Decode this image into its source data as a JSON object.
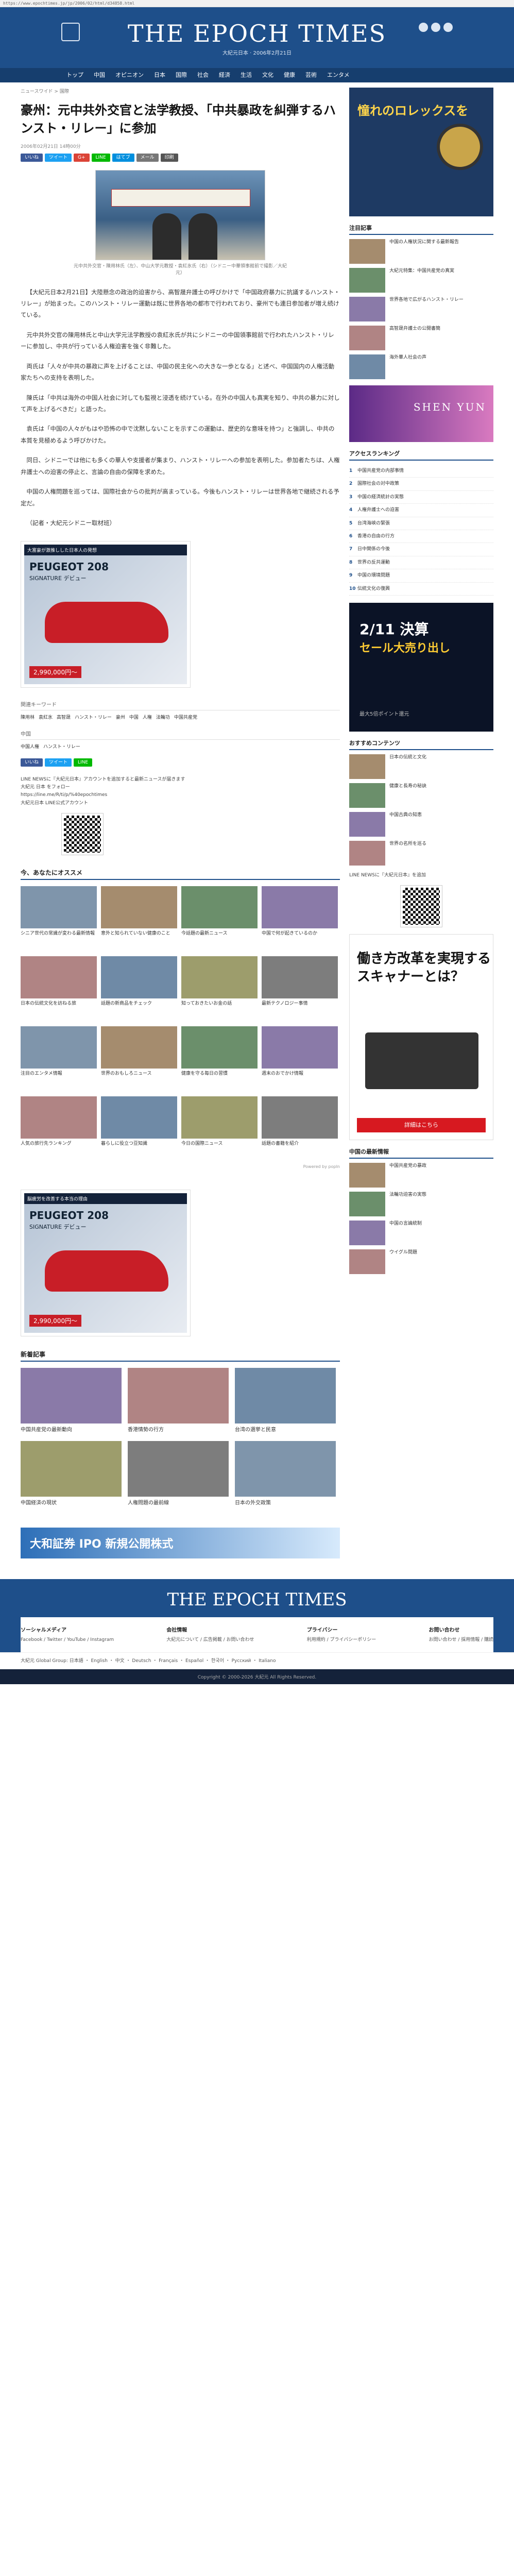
{
  "browser": {
    "url": "https://www.epochtimes.jp/jp/2006/02/html/d34858.html"
  },
  "masthead": {
    "logo": "THE EPOCH TIMES",
    "subtitle": "大紀元日本 · 2006年2月21日"
  },
  "nav": [
    "トップ",
    "中国",
    "オピニオン",
    "日本",
    "国際",
    "社会",
    "経済",
    "生活",
    "文化",
    "健康",
    "芸術",
    "エンタメ"
  ],
  "breadcrumb": "ニュースワイド > 国際",
  "article": {
    "title": "豪州：元中共外交官と法学教授、「中共暴政を糾弾するハンスト・リレー」に参加",
    "meta": "2006年02月21日 14時00分",
    "share": [
      "いいね",
      "ツイート",
      "G+",
      "LINE",
      "はてブ",
      "メール",
      "印刷"
    ],
    "photo_caption": "元中共外交官・陳用林氏（左）、中山大学元教授・袁紅氷氏（右）（シドニー中華領事館前で撮影／大紀元）",
    "paragraphs": [
      "【大紀元日本2月21日】大陸懸念の政治的迫害から、高智晟弁護士の呼びかけで「中国政府暴力に抗議するハンスト・リレー」が始まった。このハンスト・リレー運動は既に世界各地の都市で行われており、豪州でも連日参加者が増え続けている。",
      "元中共外交官の陳用林氏と中山大学元法学教授の袁紅氷氏が共にシドニーの中国領事館前で行われたハンスト・リレーに参加し、中共が行っている人権迫害を強く非難した。",
      "両氏は「人々が中共の暴政に声を上げることは、中国の民主化への大きな一歩となる」と述べ、中国国内の人権活動家たちへの支持を表明した。",
      "陳氏は「中共は海外の中国人社会に対しても監視と浸透を続けている。在外の中国人も真実を知り、中共の暴力に対して声を上げるべきだ」と語った。",
      "袁氏は「中国の人々がもはや恐怖の中で沈黙しないことを示すこの運動は、歴史的な意味を持つ」と強調し、中共の本質を見極めるよう呼びかけた。",
      "同日、シドニーでは他にも多くの華人や支援者が集まり、ハンスト・リレーへの参加を表明した。参加者たちは、人権弁護士への迫害の停止と、言論の自由の保障を求めた。",
      "中国の人権問題を巡っては、国際社会からの批判が高まっている。今後もハンスト・リレーは世界各地で継続される予定だ。",
      "（記者・大紀元シドニー取材班）"
    ]
  },
  "inline_ad": {
    "header": "大富豪が激推しした日本人の発想",
    "brand": "PEUGEOT 208",
    "model": "SIGNATURE デビュー",
    "price": "2,990,000円〜"
  },
  "tags": {
    "heading": "関連キーワード",
    "items": [
      "陳用林",
      "袁紅氷",
      "高智晟",
      "ハンスト・リレー",
      "豪州",
      "中国",
      "人権",
      "法輪功",
      "中国共産党"
    ],
    "subheading": "中国",
    "sub_items": [
      "中国人権",
      "ハンスト・リレー"
    ]
  },
  "line": {
    "text": "LINE NEWSに『大紀元日本』アカウントを追加すると最新ニュースが届きます",
    "follow_label": "大紀元 日本 をフォロー",
    "url": "https://line.me/R/ti/p/%40epochtimes",
    "note": "大紀元日本 LINE公式アカウント"
  },
  "recommend": {
    "heading": "今、あなたにオススメ",
    "pr_note": "Powered by popIn",
    "items": [
      "シニア世代の常識が変わる最新情報",
      "意外と知られていない健康のこと",
      "今話題の最新ニュース",
      "中国で何が起きているのか",
      "日本の伝統文化を訪ねる旅",
      "話題の新商品をチェック",
      "知っておきたいお金の話",
      "最新テクノロジー事情",
      "注目のエンタメ情報",
      "世界のおもしろニュース",
      "健康を守る毎日の習慣",
      "週末のおでかけ情報",
      "人気の旅行先ランキング",
      "暮らしに役立つ豆知識",
      "今日の国際ニュース",
      "話題の書籍を紹介"
    ]
  },
  "bottom_ad": {
    "header": "脳疲労を改善する本当の理由",
    "brand": "PEUGEOT 208",
    "model": "SIGNATURE デビュー",
    "price": "2,990,000円〜"
  },
  "latest": {
    "heading": "新着記事",
    "items": [
      "中国共産党の最新動向",
      "香港情勢の行方",
      "台湾の選挙と民意",
      "中国経済の現状",
      "人権問題の最前線",
      "日本の外交政策"
    ]
  },
  "pagead": {
    "title": "大和証券 IPO 新規公開株式"
  },
  "sidebar": {
    "top_ad_text": "憧れのロレックスを",
    "popular_heading": "注目記事",
    "popular": [
      "中国の人権状況に関する最新報告",
      "大紀元特集：中国共産党の真実",
      "世界各地で広がるハンスト・リレー",
      "高智晟弁護士の公開書簡",
      "海外華人社会の声"
    ],
    "shen_yun": "SHEN YUN",
    "ranking_heading": "アクセスランキング",
    "ranking": [
      "中国共産党の内部事情",
      "国際社会の対中政策",
      "中国の経済統計の実態",
      "人権弁護士への迫害",
      "台湾海峡の緊張",
      "香港の自由の行方",
      "日中関係の今後",
      "世界の反共運動",
      "中国の環境問題",
      "伝統文化の復興"
    ],
    "sale_ad": {
      "d1": "2/11 決算",
      "d2": "セール大売り出し",
      "d3": "最大5倍ポイント還元"
    },
    "more_heading": "おすすめコンテンツ",
    "more": [
      "日本の伝統と文化",
      "健康と長寿の秘訣",
      "中国古典の知恵",
      "世界の名所を巡る"
    ],
    "line_follow": "LINE NEWSに『大紀元日本』を追加",
    "fuji_ad": {
      "h": "働き方改革を実現するスキャナーとは？",
      "btn": "詳細はこちら"
    },
    "ranking2_heading": "中国の最新情報",
    "ranking2": [
      "中国共産党の暴政",
      "法輪功迫害の実態",
      "中国の言論統制",
      "ウイグル問題"
    ]
  },
  "footer": {
    "logo": "THE EPOCH TIMES",
    "cols": [
      {
        "h": "ソーシャルメディア",
        "p": "Facebook / Twitter / YouTube / Instagram"
      },
      {
        "h": "会社情報",
        "p": "大紀元について / 広告掲載 / お問い合わせ"
      },
      {
        "h": "プライバシー",
        "p": "利用規約 / プライバシーポリシー"
      },
      {
        "h": "お問い合わせ",
        "p": "お問い合わせ / 採用情報 / 購読"
      }
    ],
    "links": "大紀元 Global Group: 日本語 ・ English ・ 中文 ・ Deutsch ・ Français ・ Español ・ 한국어 ・ Русский ・ Italiano",
    "copyright": "Copyright © 2000-2026 大紀元 All Rights Reserved."
  }
}
